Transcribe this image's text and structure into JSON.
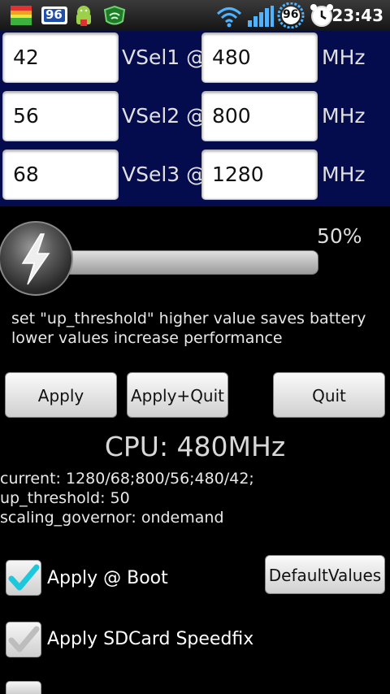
{
  "status_bar": {
    "notification_badge": "96",
    "battery_level": "96",
    "time": "23:43"
  },
  "vsel": [
    {
      "value": "42",
      "label": "VSel1 @",
      "freq": "480",
      "unit": "MHz"
    },
    {
      "value": "56",
      "label": "VSel2 @",
      "freq": "800",
      "unit": "MHz"
    },
    {
      "value": "68",
      "label": "VSel3 @",
      "freq": "1280",
      "unit": "MHz"
    }
  ],
  "slider": {
    "percent": "50%",
    "fraction": 0.5
  },
  "hint": {
    "line1": "set \"up_threshold\" higher value saves battery",
    "line2": "lower values increase performance"
  },
  "buttons": {
    "apply": "Apply",
    "apply_quit": "Apply+Quit",
    "quit": "Quit",
    "default_values": "DefaultValues"
  },
  "cpu": "CPU: 480MHz",
  "stats": {
    "current": "current:  1280/68;800/56;480/42;",
    "up_threshold": "up_threshold:  50",
    "governor": "scaling_governor:  ondemand"
  },
  "options": {
    "apply_boot": {
      "label": "Apply @ Boot",
      "checked": true
    },
    "sdcard": {
      "label": "Apply SDCard Speedfix",
      "checked": false
    }
  },
  "colors": {
    "panel_bg": "#050c4e",
    "check": "#1ec8dc"
  }
}
